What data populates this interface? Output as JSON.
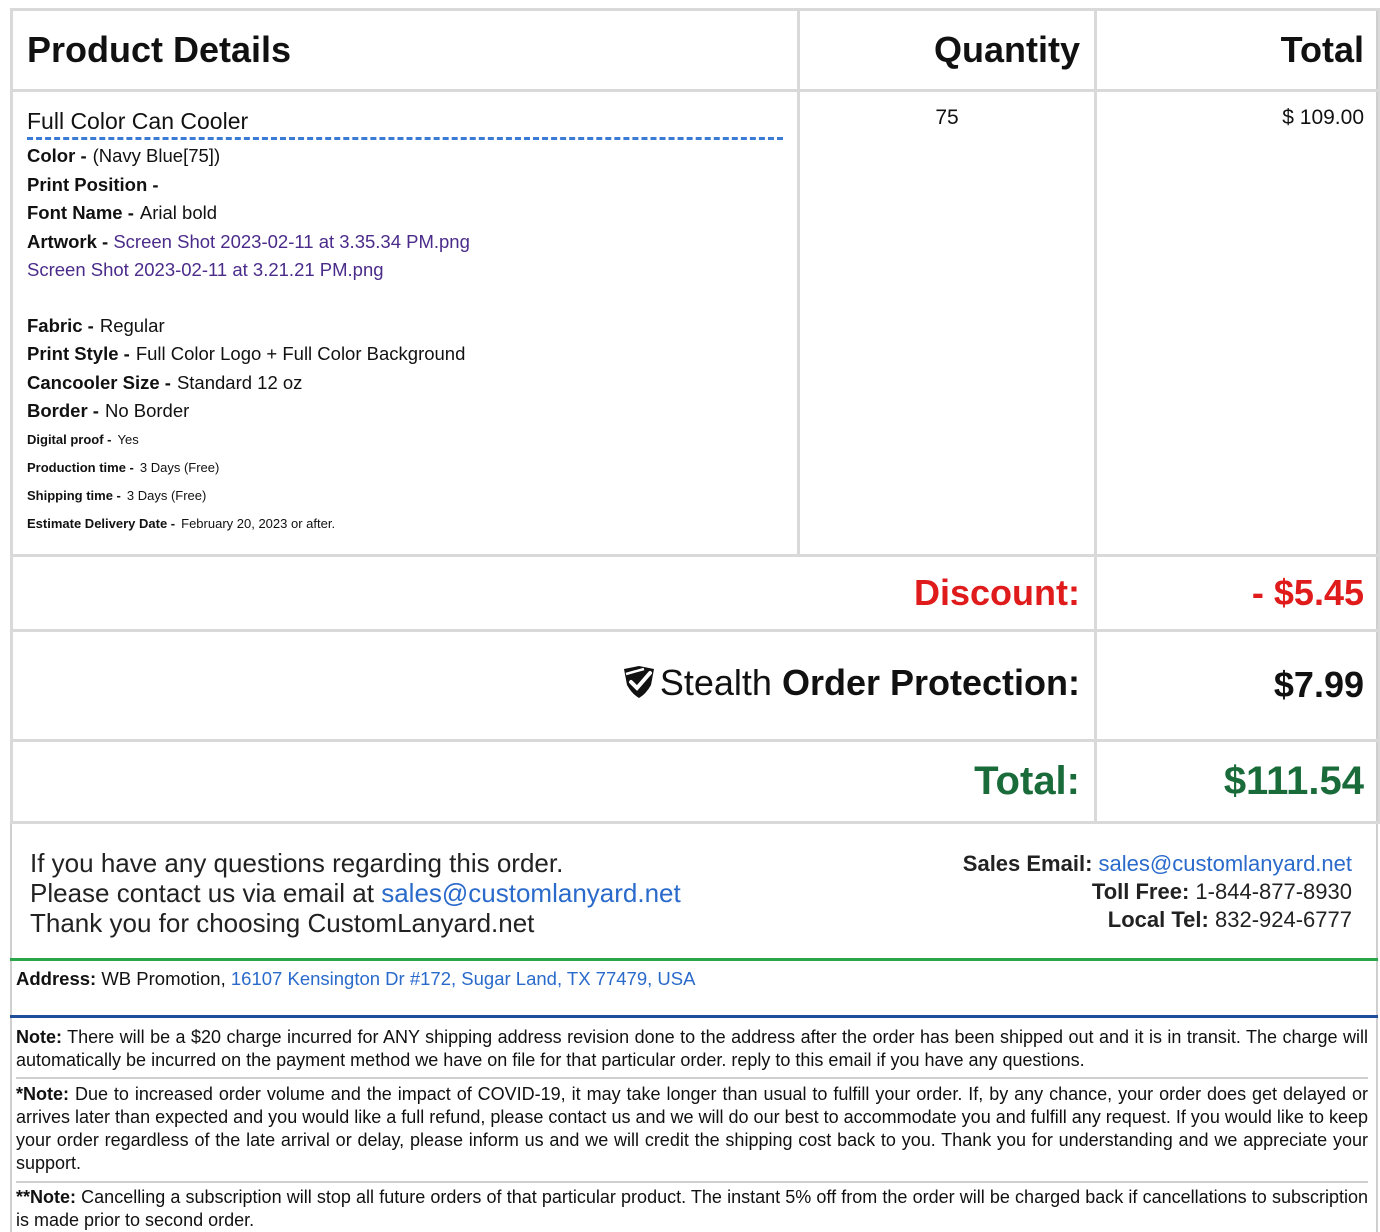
{
  "table": {
    "headers": {
      "details": "Product Details",
      "quantity": "Quantity",
      "total": "Total"
    },
    "product": {
      "name": "Full Color Can Cooler",
      "quantity": "75",
      "price": "$ 109.00",
      "attributes": [
        {
          "label": "Color -",
          "value": "(Navy Blue[75])"
        },
        {
          "label": "Print Position -",
          "value": ""
        },
        {
          "label": "Font Name -",
          "value": "Arial bold"
        }
      ],
      "artwork_label": "Artwork -",
      "artwork_files": [
        "Screen Shot 2023-02-11 at 3.35.34 PM.png",
        "Screen Shot 2023-02-11 at 3.21.21 PM.png"
      ],
      "attributes2": [
        {
          "label": "Fabric -",
          "value": "Regular"
        },
        {
          "label": "Print Style -",
          "value": "Full Color Logo + Full Color Background"
        },
        {
          "label": "Cancooler Size -",
          "value": "Standard 12 oz"
        },
        {
          "label": "Border -",
          "value": "No Border"
        }
      ],
      "small_attributes": [
        {
          "label": "Digital proof -",
          "value": "Yes"
        },
        {
          "label": "Production time -",
          "value": "3 Days (Free)"
        },
        {
          "label": "Shipping time -",
          "value": "3 Days (Free)"
        },
        {
          "label": "Estimate Delivery Date -",
          "value": "February 20, 2023 or after."
        }
      ]
    },
    "summary": {
      "discount_label": "Discount:",
      "discount_value": "- $5.45",
      "protection_brand": "Stealth",
      "protection_label": "Order Protection:",
      "protection_value": "$7.99",
      "total_label": "Total:",
      "total_value": "$111.54"
    }
  },
  "contact": {
    "line1": "If you have any questions regarding this order.",
    "line2_prefix": "Please contact us via email at",
    "email": "sales@customlanyard.net",
    "line3": "Thank you for choosing CustomLanyard.net",
    "sales_email_label": "Sales Email:",
    "toll_free_label": "Toll Free:",
    "toll_free": "1-844-877-8930",
    "local_tel_label": "Local Tel:",
    "local_tel": "832-924-6777"
  },
  "address": {
    "label": "Address:",
    "company": "WB Promotion,",
    "street": "16107 Kensington Dr #172, Sugar Land, TX 77479, USA"
  },
  "notes": [
    {
      "label": "Note:",
      "text": "There will be a $20 charge incurred for ANY shipping address revision done to the address after the order has been shipped out and it is in transit. The charge will automatically be incurred on the payment method we have on file for that particular order. reply to this email if you have any questions."
    },
    {
      "label": "*Note:",
      "text": "Due to increased order volume and the impact of COVID-19, it may take longer than usual to fulfill your order. If, by any chance, your order does get delayed or arrives later than expected and you would like a full refund, please contact us and we will do our best to accommodate you and fulfill any request. If you would like to keep your order regardless of the late arrival or delay, please inform us and we will credit the shipping cost back to you. Thank you for understanding and we appreciate your support."
    },
    {
      "label": "**Note:",
      "text": "Cancelling a subscription will stop all future orders of that particular product. The instant 5% off from the order will be charged back if cancellations to subscription is made prior to second order."
    }
  ],
  "colors": {
    "discount": "#e01b1b",
    "total": "#1a6b3a",
    "link": "#2a6acb",
    "green_rule": "#2aa64a",
    "blue_rule": "#1f4e9b"
  },
  "icons": {
    "protection": "shield-check-icon"
  }
}
